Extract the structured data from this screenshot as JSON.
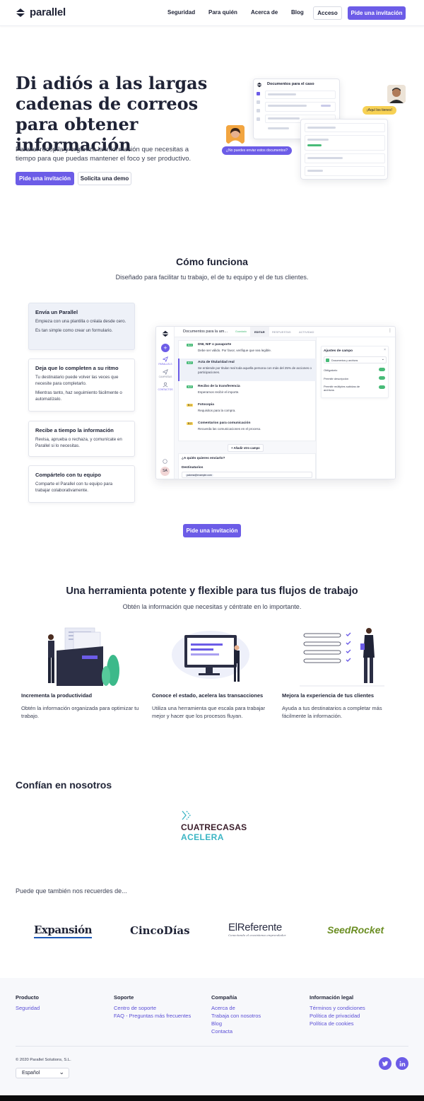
{
  "nav": {
    "logo_text": "parallel",
    "links": [
      "Seguridad",
      "Para quién",
      "Acerca de",
      "Blog"
    ],
    "login": "Acceso",
    "cta": "Pide una invitación"
  },
  "hero": {
    "title": "Di adiós a las largas cadenas de correos para obtener información",
    "description": "Parallel recopila y organiza la información que necesitas a tiempo para que puedas mantener el foco y ser productivo.",
    "primary_button": "Pide una invitación",
    "secondary_button": "Solicita una demo",
    "mock": {
      "card_title": "Documentos para el caso",
      "bubble_question": "¿No puedes enviar estos documentos?",
      "bubble_answer": "¡Aquí los tienes!"
    }
  },
  "how": {
    "title": "Cómo funciona",
    "subtitle": "Diseñado para facilitar tu trabajo, el de tu equipo y el de tus clientes.",
    "steps": [
      {
        "title": "Envía un Parallel",
        "text1": "Empieza con una plantilla o créala desde cero.",
        "text2": "Es tan simple como crear un formulario."
      },
      {
        "title": "Deja que lo completen a su ritmo",
        "text1": "Tu destinatario puede volver las veces que necesite para completarlo.",
        "text2": "Mientras tanto, haz seguimiento fácilmente o automatízalo."
      },
      {
        "title": "Recibe a tiempo la información",
        "text1": "Revisa, aprueba o rechaza, y comunícate en Parallel si lo necesitas."
      },
      {
        "title": "Compártelo con tu equipo",
        "text1": "Comparte el Parallel con tu equipo para trabajar colaborativamente."
      }
    ],
    "app": {
      "doc_title": "Documentos para la am...",
      "saved": "Guardado",
      "tabs": [
        "EDITAR",
        "RESPUESTAS",
        "ACTIVIDAD"
      ],
      "sidebar": [
        "PARALLELS",
        "CAMPAÑAS",
        "CONTACTOS"
      ],
      "avatar_initials": "SA",
      "fields": [
        {
          "title": "DNI, NIF o pasaporte",
          "desc": "Debe ser válido. Por favor, verifique que sea legible.",
          "tag": "A.1"
        },
        {
          "title": "Acta de titularidad real",
          "desc": "Se entiende por titular real toda aquella persona con más del 25% de acciones o participaciones.",
          "tag": "A.2"
        },
        {
          "title": "Recibo de la transferencia",
          "desc": "Esperamos recibir el importe.",
          "tag": "A.3"
        },
        {
          "title": "Fotocopia",
          "desc": "Requisitos para la compra.",
          "tag": "B.1"
        },
        {
          "title": "Comentarios para comunicación",
          "desc": "Recuerda las comunicaciones en el proceso.",
          "tag": "B.2"
        }
      ],
      "add_field": "+ Añadir otro campo",
      "who_send": "¿A quién quieres enviarlo?",
      "recipients_label": "Destinatarios",
      "recipient_chip": "paloma@example.com",
      "panel": {
        "title": "Ajustes de campo",
        "type": "Documentos y archivos",
        "options": [
          "Obligatorio",
          "Permitir descripción",
          "Permitir múltiples subidas de archivos"
        ]
      }
    },
    "cta": "Pide una invitación"
  },
  "features": {
    "title": "Una herramienta potente y flexible para tus flujos de trabajo",
    "subtitle": "Obtén la información que necesitas y céntrate en lo importante.",
    "items": [
      {
        "title": "Incrementa la productividad",
        "text": "Obtén la información organizada para optimizar tu trabajo."
      },
      {
        "title": "Conoce el estado, acelera las transacciones",
        "text": "Utiliza una herramienta que escala para trabajar mejor y hacer que los procesos fluyan."
      },
      {
        "title": "Mejora la experiencia de tus clientes",
        "text": "Ayuda a tus destinatarios a completar más fácilmente la información."
      }
    ]
  },
  "trust": {
    "title": "Confían en nosotros",
    "client_line1": "CUATRECASAS",
    "client_line2": "ACELERA"
  },
  "press": {
    "title": "Puede que también nos recuerdes de...",
    "logos": [
      "Expansión",
      "CincoDías",
      "ElReferente",
      "SeedRocket"
    ],
    "referente_tagline": "Conectando el ecosistema emprendedor"
  },
  "footer": {
    "columns": [
      {
        "title": "Producto",
        "links": [
          "Seguridad"
        ]
      },
      {
        "title": "Soporte",
        "links": [
          "Centro de soporte",
          "FAQ - Preguntas más frecuentes"
        ]
      },
      {
        "title": "Compañía",
        "links": [
          "Acerca de",
          "Trabaja con nosotros",
          "Blog",
          "Contacta"
        ]
      },
      {
        "title": "Información legal",
        "links": [
          "Términos y condiciones",
          "Política de privacidad",
          "Política de cookies"
        ]
      }
    ],
    "copyright": "© 2020 Parallel Solutions, S.L.",
    "language": "Español"
  },
  "colors": {
    "brand": "#6c5ce7",
    "link": "#5b4fd6",
    "text": "#1f2336",
    "bubble_yellow": "#f7d154"
  }
}
